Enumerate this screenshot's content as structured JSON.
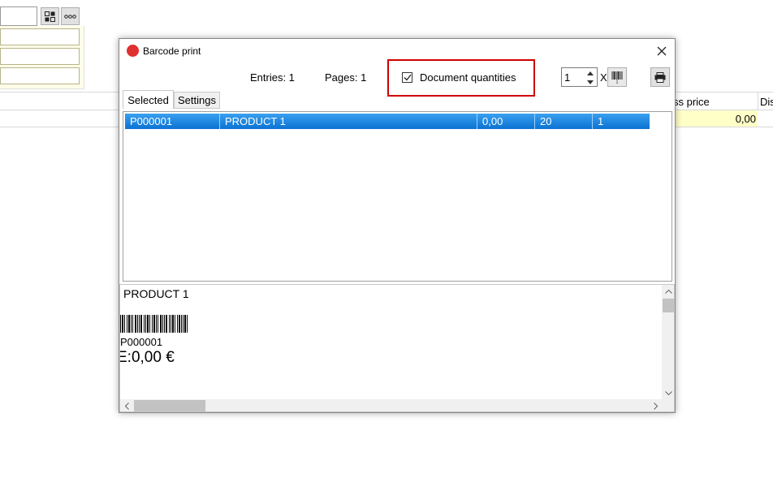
{
  "background": {
    "grid_headers": [
      "ss price",
      "Dis"
    ],
    "grid_value": "0,00"
  },
  "dialog": {
    "title": "Barcode print",
    "entries_label": "Entries: 1",
    "pages_label": "Pages: 1",
    "document_quantities_label": "Document quantities",
    "document_quantities_checked": true,
    "copies_value": "1",
    "times_label": "X",
    "tabs": [
      {
        "label": "Selected",
        "active": true
      },
      {
        "label": "Settings",
        "active": false
      }
    ],
    "rows": [
      {
        "code": "P000001",
        "name": "PRODUCT 1",
        "price": "0,00",
        "qty": "20",
        "count": "1",
        "selected": true
      }
    ],
    "preview": {
      "product_name": "PRODUCT 1",
      "barcode_text": "P000001",
      "price_text": "E:0,00 €"
    },
    "colors": {
      "highlight_box": "#d00000",
      "selection": "#0a72d2"
    }
  }
}
